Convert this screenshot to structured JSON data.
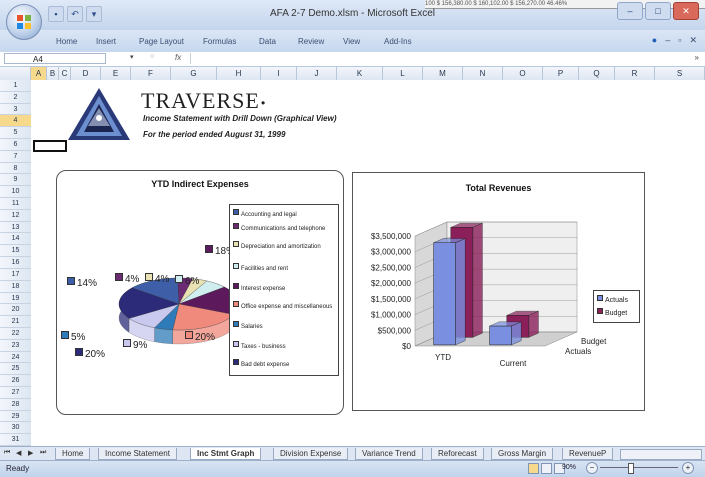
{
  "window": {
    "title": "AFA 2-7 Demo.xlsm - Microsoft Excel"
  },
  "peek_text": "100  $ 156,380.00  $  160,102.00  $  156,270.00   46.46%",
  "qat": [
    "save-icon",
    "undo-icon",
    "redo-icon"
  ],
  "ribbon": {
    "tabs": [
      "Home",
      "Insert",
      "Page Layout",
      "Formulas",
      "Data",
      "Review",
      "View",
      "Add-Ins"
    ]
  },
  "formula_bar": {
    "name_box": "A4",
    "fx": "fx",
    "content": ""
  },
  "columns": [
    "A",
    "B",
    "C",
    "D",
    "E",
    "F",
    "G",
    "H",
    "I",
    "J",
    "K",
    "L",
    "M",
    "N",
    "O",
    "P",
    "Q",
    "R",
    "S"
  ],
  "rows": [
    "1",
    "2",
    "3",
    "4",
    "5",
    "6",
    "7",
    "8",
    "9",
    "10",
    "11",
    "12",
    "13",
    "14",
    "15",
    "16",
    "17",
    "18",
    "19",
    "20",
    "21",
    "22",
    "23",
    "24",
    "25",
    "26",
    "27",
    "28",
    "29",
    "30",
    "31"
  ],
  "header": {
    "brand": "TRAVERSE",
    "brand_mark": "•",
    "subtitle": "Income Statement with Drill Down (Graphical View)",
    "period": "For the period ended August 31, 1999"
  },
  "colors": {
    "pie": [
      "#3e5fa8",
      "#6b2b72",
      "#e9e2b3",
      "#d0eef0",
      "#5c1a5c",
      "#f08a7c",
      "#2f7ab8",
      "#c9c9ef",
      "#2b2b7a"
    ],
    "actuals": "#7b8fe0",
    "budget": "#8a1f5a"
  },
  "chart_data": [
    {
      "type": "pie",
      "title": "YTD Indirect Expenses",
      "categories": [
        "Accounting and legal",
        "Communications and telephone",
        "Depreciation and amortization",
        "Facilities and rent",
        "Interest expense",
        "Office expense and miscellaneous",
        "Salaries",
        "Taxes - business",
        "Bad debt expense"
      ],
      "values": [
        14,
        4,
        4,
        6,
        18,
        20,
        5,
        9,
        20
      ],
      "labels": [
        "14%",
        "4%",
        "4%",
        "6%",
        "18%",
        "20%",
        "5%",
        "9%",
        "20%"
      ],
      "legend": "right"
    },
    {
      "type": "bar",
      "title": "Total Revenues",
      "categories": [
        "YTD",
        "Current"
      ],
      "series": [
        {
          "name": "Actuals",
          "values": [
            3250000,
            600000
          ]
        },
        {
          "name": "Budget",
          "values": [
            3500000,
            700000
          ]
        }
      ],
      "depth_labels": [
        "Budget",
        "Actuals"
      ],
      "yticks": [
        "$3,500,000",
        "$3,000,000",
        "$2,500,000",
        "$2,000,000",
        "$1,500,000",
        "$1,000,000",
        "$500,000",
        "$0"
      ],
      "ylim": [
        0,
        3500000
      ],
      "legend": "right"
    }
  ],
  "sheet_tabs": [
    "Home",
    "Income Statement",
    "Inc Stmt Graph",
    "Division Expense",
    "Variance Trend",
    "Reforecast",
    "Gross Margin",
    "RevenueP"
  ],
  "active_tab": "Inc Stmt Graph",
  "status": {
    "ready": "Ready",
    "zoom": "90%"
  }
}
